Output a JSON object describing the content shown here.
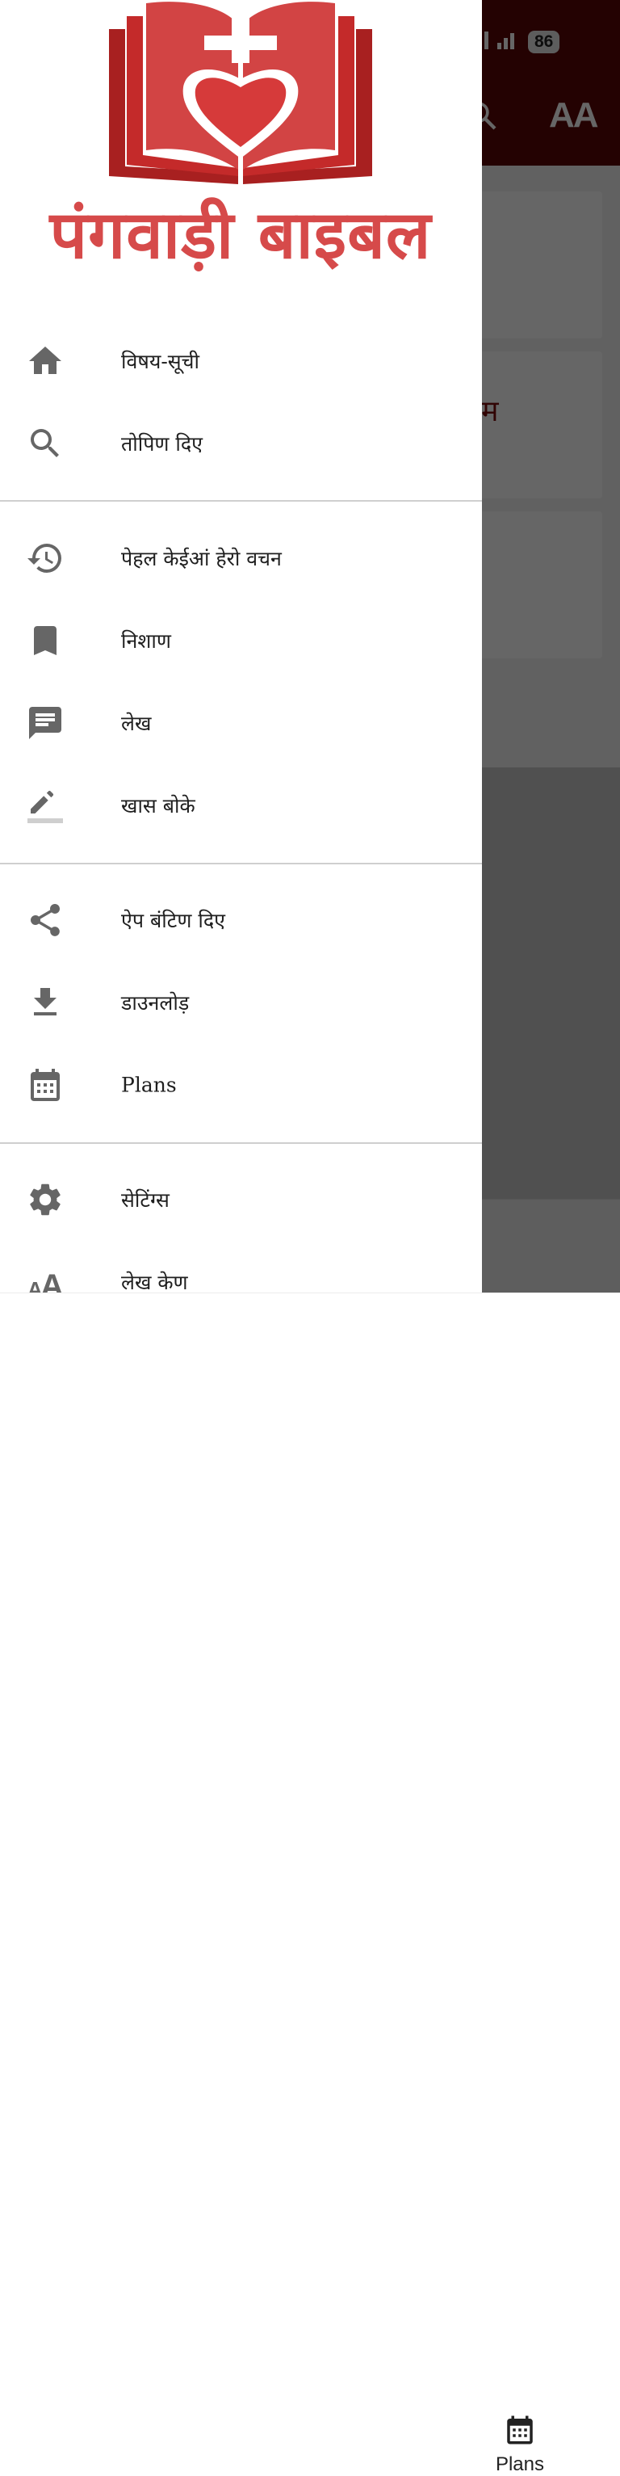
{
  "status_bar": {
    "battery": "86"
  },
  "background": {
    "card_title": "म",
    "bottom_nav": {
      "plans_label": "Plans"
    },
    "font_size_icon": "AA"
  },
  "drawer": {
    "logo_text": "पंगवाड़ी बाइबल",
    "section1": [
      {
        "label": "विषय-सूची",
        "icon": "home-icon"
      },
      {
        "label": "तोपिण दिए",
        "icon": "search-icon"
      }
    ],
    "section2": [
      {
        "label": "पेहल केईआं हेरो वचन",
        "icon": "history-icon"
      },
      {
        "label": "निशाण",
        "icon": "bookmark-icon"
      },
      {
        "label": "लेख",
        "icon": "note-icon"
      },
      {
        "label": "खास बोके",
        "icon": "highlight-pen-icon"
      }
    ],
    "section3": [
      {
        "label": "ऐप बंटिण दिए",
        "icon": "share-icon"
      },
      {
        "label": "डाउनलोड़",
        "icon": "download-icon"
      },
      {
        "label": "Plans",
        "icon": "calendar-icon"
      }
    ],
    "section4": [
      {
        "label": "सेटिंग्स",
        "icon": "gear-icon"
      },
      {
        "label": "लेख केण",
        "icon": "text-size-icon"
      }
    ]
  },
  "colors": {
    "logo_red": "#d64a4a",
    "icon_gray": "#666666",
    "appbar_dark": "#5a0505"
  }
}
